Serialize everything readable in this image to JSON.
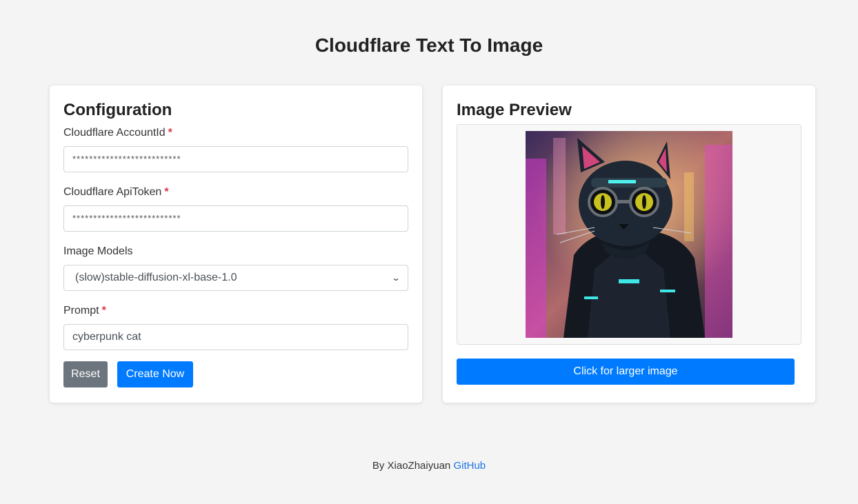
{
  "page": {
    "title": "Cloudflare Text To Image"
  },
  "config": {
    "heading": "Configuration",
    "account_label": "Cloudflare AccountId",
    "account_value": "**************************",
    "token_label": "Cloudflare ApiToken",
    "token_value": "**************************",
    "required_mark": "*",
    "models_label": "Image Models",
    "model_selected": "(slow)stable-diffusion-xl-base-1.0",
    "prompt_label": "Prompt",
    "prompt_value": "cyberpunk cat",
    "reset_label": "Reset",
    "create_label": "Create Now"
  },
  "preview": {
    "heading": "Image Preview",
    "larger_label": "Click for larger image"
  },
  "footer": {
    "by_text": "By XiaoZhaiyuan",
    "link_text": "GitHub"
  },
  "colors": {
    "primary": "#007bff",
    "secondary": "#6c757d",
    "required": "#dc3545",
    "background": "#f4f4f4"
  }
}
